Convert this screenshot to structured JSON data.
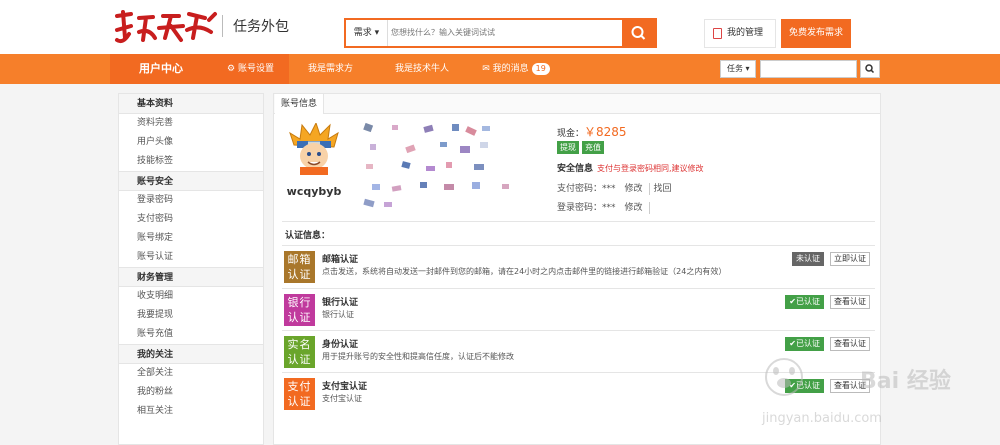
{
  "header": {
    "logo_text": "猪八戒",
    "subtitle": "任务外包",
    "search_type": "需求",
    "search_placeholder": "您想找什么？输入关键词试试",
    "manage_label": "我的管理",
    "post_label": "免费发布需求"
  },
  "nav": {
    "user_center": "用户中心",
    "items": [
      {
        "label": "账号设置",
        "icon": "gears-icon"
      },
      {
        "label": "我是需求方"
      },
      {
        "label": "我是技术牛人"
      },
      {
        "label": "我的消息",
        "icon": "envelope-icon",
        "badge": "19"
      }
    ],
    "select_label": "任务"
  },
  "sidebar": {
    "sections": [
      {
        "title": "基本资料",
        "items": [
          "资料完善",
          "用户头像",
          "技能标签"
        ]
      },
      {
        "title": "账号安全",
        "items": [
          "登录密码",
          "支付密码",
          "账号绑定",
          "账号认证"
        ]
      },
      {
        "title": "财务管理",
        "items": [
          "收支明细",
          "我要提现",
          "账号充值"
        ]
      },
      {
        "title": "我的关注",
        "items": [
          "全部关注",
          "我的粉丝",
          "相互关注"
        ]
      }
    ]
  },
  "account": {
    "tab": "账号信息",
    "username": "wcqybyb",
    "cash_label": "现金：",
    "cash_value": "￥8285",
    "withdraw_label": "提现",
    "recharge_label": "充值",
    "security_label": "安全信息",
    "security_warning": "支付与登录密码相同,建议修改",
    "pay_pw_label": "支付密码：***",
    "login_pw_label": "登录密码：***",
    "modify_label": "修改",
    "retrieve_label": "找回"
  },
  "auth": {
    "title": "认证信息：",
    "items": [
      {
        "icon_text": "邮箱认证",
        "color": "#a9772b",
        "name": "邮箱认证",
        "desc": "点击发送，系统将自动发送一封邮件到您的邮箱，请在24小时之内点击邮件里的链接进行邮箱验证（24之内有效）",
        "status": "未认证",
        "status_color": "#666666",
        "action": "立即认证"
      },
      {
        "icon_text": "银行认证",
        "color": "#c03a9d",
        "name": "银行认证",
        "desc": "银行认证",
        "status": "✔已认证",
        "status_color": "#43a047",
        "action": "查看认证"
      },
      {
        "icon_text": "实名认证",
        "color": "#6aa52b",
        "name": "身份认证",
        "desc": "用于提升账号的安全性和提高信任度，认证后不能修改",
        "status": "✔已认证",
        "status_color": "#43a047",
        "action": "查看认证"
      },
      {
        "icon_text": "支付认证",
        "color": "#f26a21",
        "name": "支付宝认证",
        "desc": "支付宝认证",
        "status": "✔已认证",
        "status_color": "#43a047",
        "action": "查看认证"
      }
    ]
  },
  "watermark": {
    "title": "Bai 经验",
    "url": "jingyan.baidu.com"
  }
}
